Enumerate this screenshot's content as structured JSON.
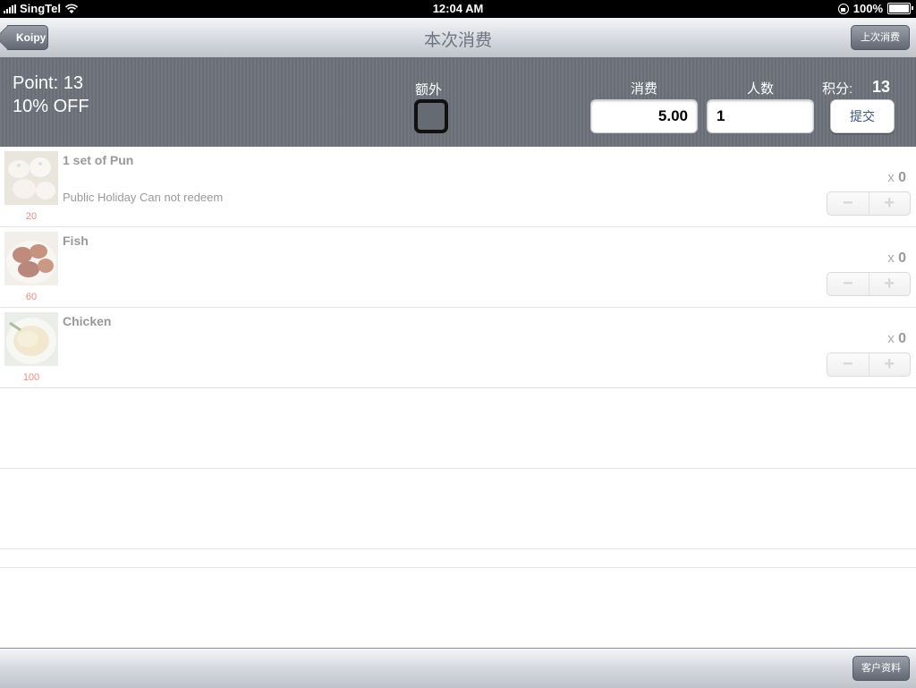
{
  "status_bar": {
    "carrier": "SingTel",
    "time": "12:04 AM",
    "battery": "100%",
    "battery_level": 1.0
  },
  "nav": {
    "back_label": "Koipy",
    "title": "本次消费",
    "right_button": "上次消费"
  },
  "summary": {
    "points": "Point: 13",
    "discount": "10% OFF",
    "extra_label": "额外",
    "extra_checked": false,
    "spend_label": "消费",
    "spend_value": "5.00",
    "people_label": "人数",
    "people_value": "1",
    "score_label": "积分:",
    "score_value": "13",
    "submit_label": "提交"
  },
  "items": [
    {
      "name": "1 set of Pun",
      "note": "Public Holiday Can not redeem",
      "price": "20",
      "qty_prefix": "x",
      "qty": "0",
      "image": "dumplings-photo"
    },
    {
      "name": "Fish",
      "note": "",
      "price": "60",
      "qty_prefix": "x",
      "qty": "0",
      "image": "fish-photo"
    },
    {
      "name": "Chicken",
      "note": "",
      "price": "100",
      "qty_prefix": "x",
      "qty": "0",
      "image": "chicken-rice-photo"
    }
  ],
  "stepper": {
    "minus": "−",
    "plus": "+"
  },
  "toolbar": {
    "right_button": "客户资料"
  }
}
